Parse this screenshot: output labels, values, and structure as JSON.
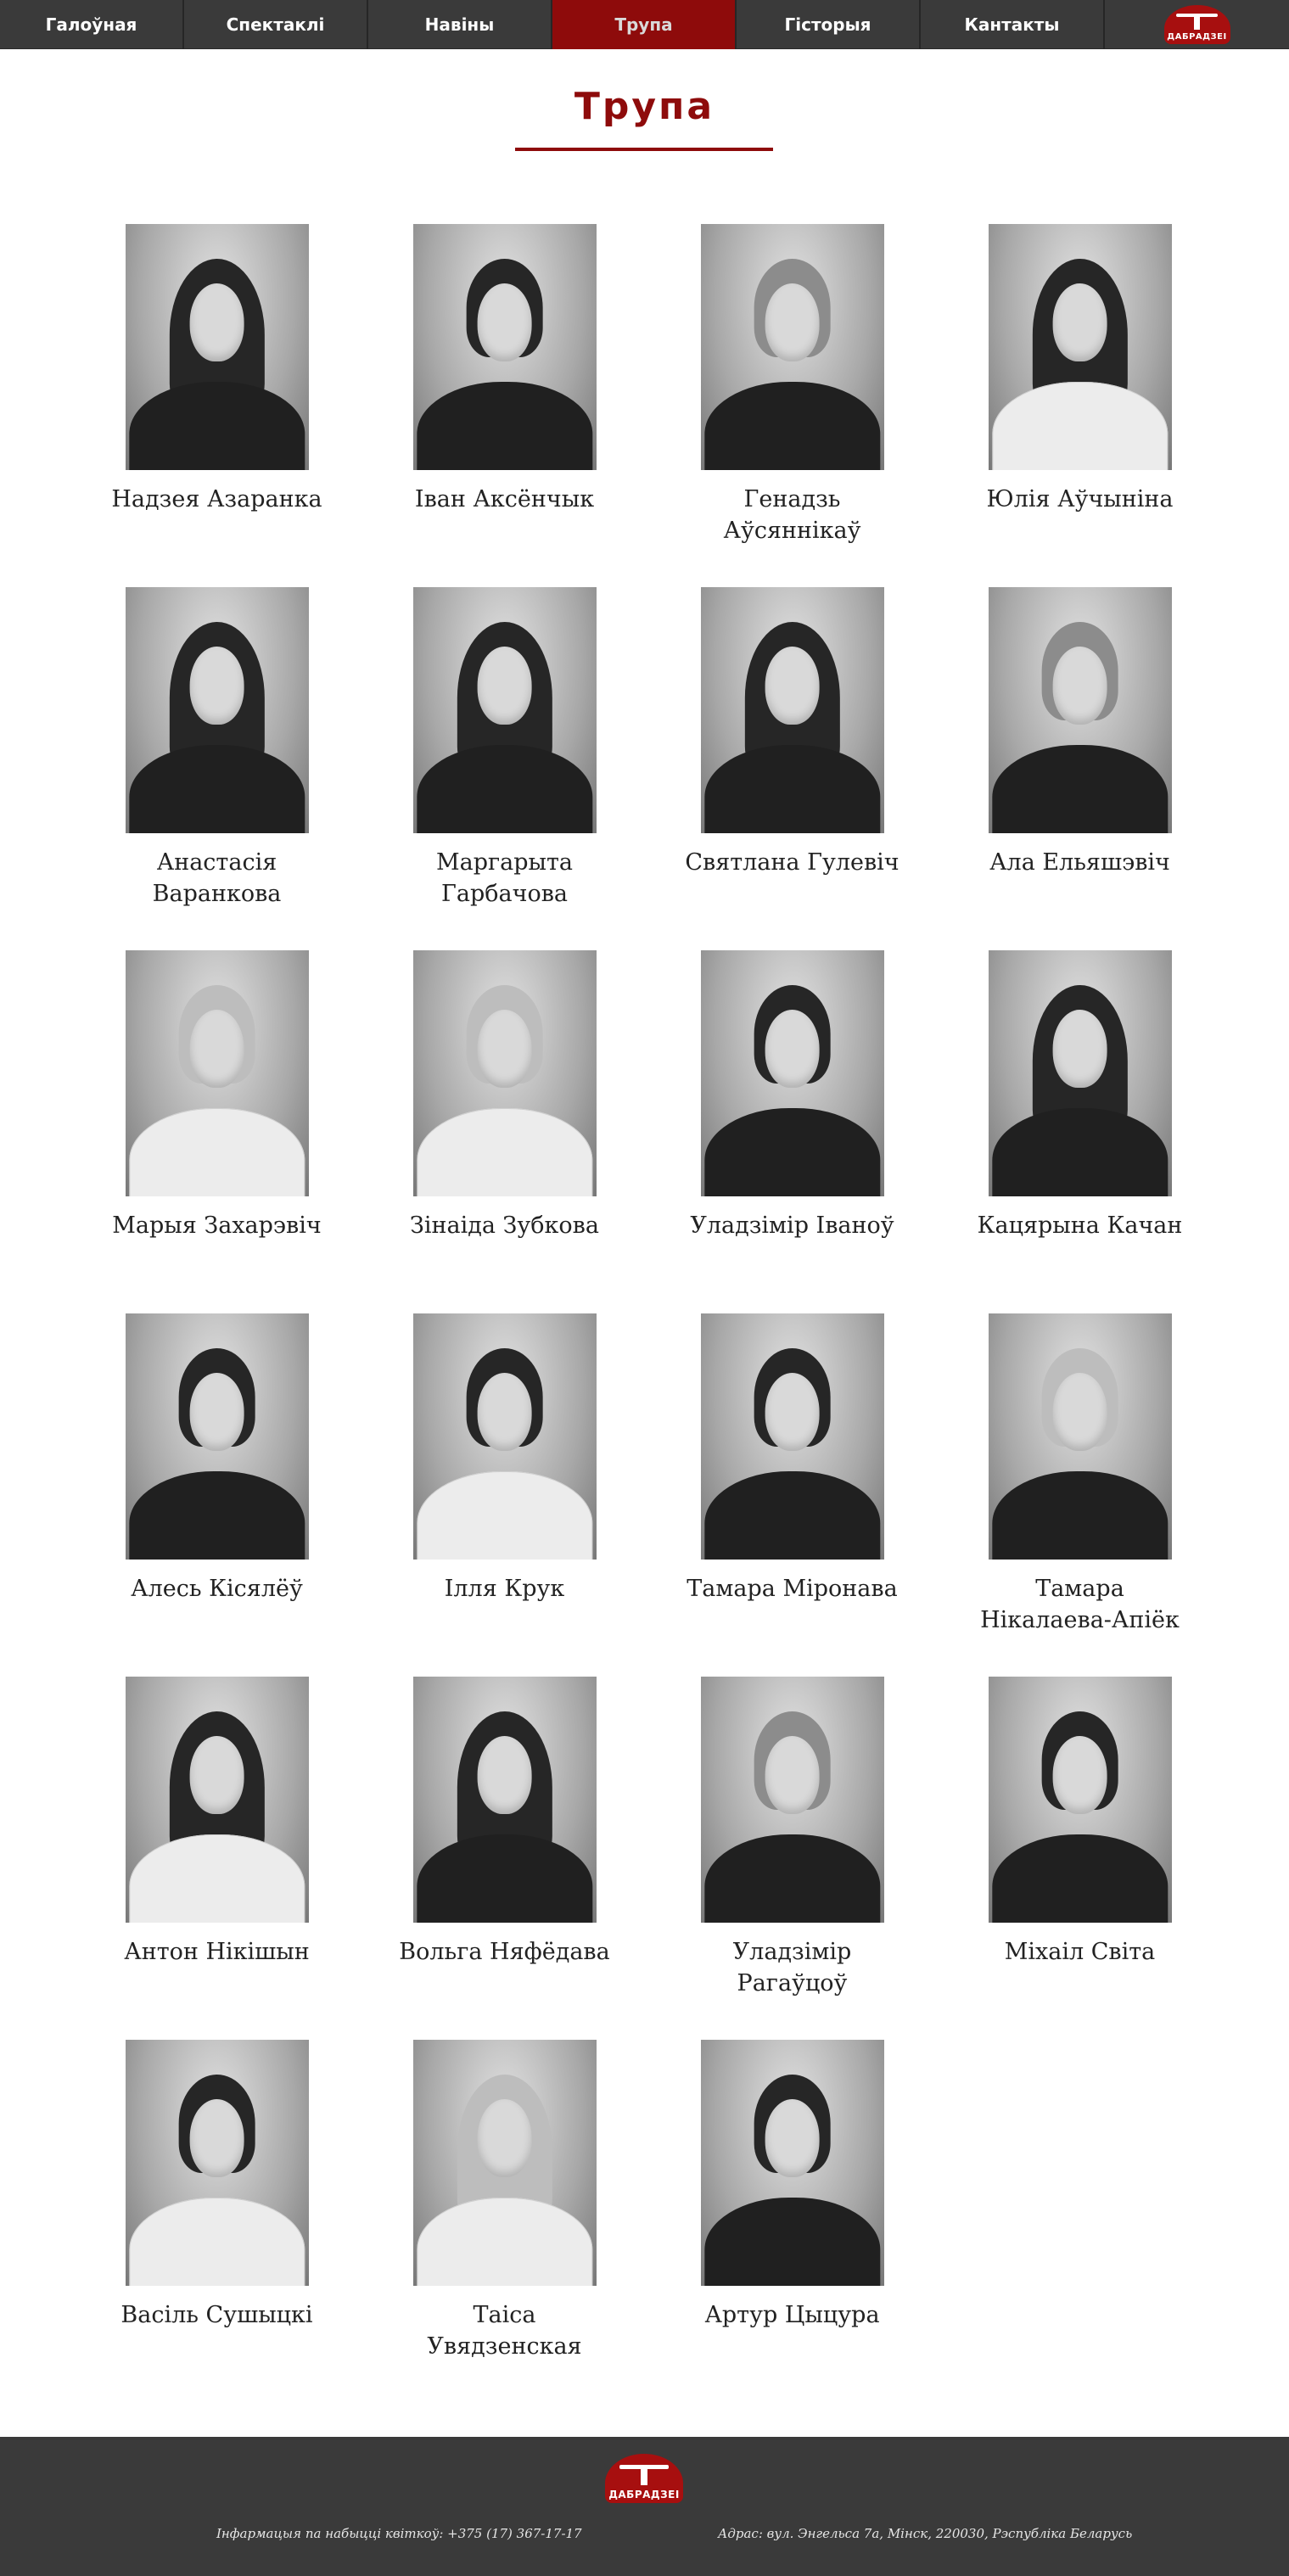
{
  "nav": {
    "items": [
      {
        "label": "Галоўная"
      },
      {
        "label": "Спектаклі"
      },
      {
        "label": "Навіны"
      },
      {
        "label": "Трупа"
      },
      {
        "label": "Гісторыя"
      },
      {
        "label": "Кантакты"
      }
    ],
    "active": "Трупа",
    "logo_text": "ДАБРАДЗЕІ"
  },
  "page": {
    "title": "Трупа"
  },
  "members": [
    {
      "name": "Надзея Азаранка"
    },
    {
      "name": "Іван Аксёнчык"
    },
    {
      "name": "Генадзь Аўсяннікаў"
    },
    {
      "name": "Юлія Аўчыніна"
    },
    {
      "name": "Анастасія Варанкова"
    },
    {
      "name": "Маргарыта Гарбачова"
    },
    {
      "name": "Святлана Гулевіч"
    },
    {
      "name": "Ала Ельяшэвіч"
    },
    {
      "name": "Марыя Захарэвіч"
    },
    {
      "name": "Зінаіда Зубкова"
    },
    {
      "name": "Уладзімір Іваноў"
    },
    {
      "name": "Кацярына Качан"
    },
    {
      "name": "Алесь Кісялёў"
    },
    {
      "name": "Ілля Крук"
    },
    {
      "name": "Тамара Міронава"
    },
    {
      "name": "Тамара Нікалаева-Апіёк"
    },
    {
      "name": "Антон Нікішын"
    },
    {
      "name": "Вольга Няфёдава"
    },
    {
      "name": "Уладзімір Рагаўцоў"
    },
    {
      "name": "Міхаіл Світа"
    },
    {
      "name": "Васіль Сушыцкі"
    },
    {
      "name": "Таіса Увядзенская"
    },
    {
      "name": "Артур Цыцура"
    }
  ],
  "footer": {
    "logo_text": "ДАБРАДЗЕІ",
    "phone_text": "Інфармацыя па набыцці квіткоў: +375 (17) 367-17-17",
    "address_text": "Адрас: вул. Энгельса 7а, Мінск, 220030, Рэспубліка Беларусь"
  },
  "colors": {
    "accent": "#8e0b0b",
    "nav_bg": "#3a3a3a",
    "footer_bg": "#3a3a3a"
  }
}
